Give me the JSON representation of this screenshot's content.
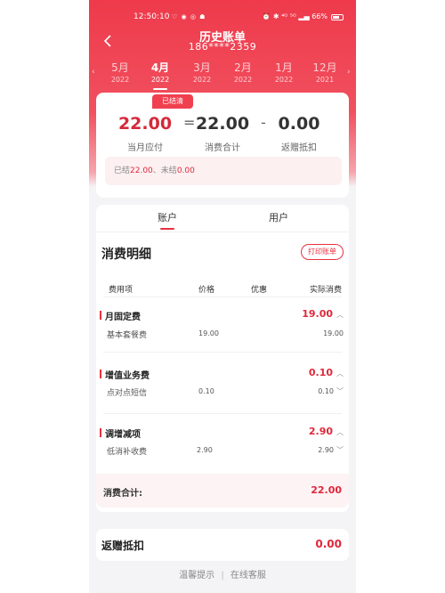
{
  "status": {
    "time": "12:50:10",
    "app_icons": "♡ ◉ ◎ ☗",
    "right_text": "⏰ ✱ ⁴ᴳ ⁵ᴳ ▂▄ 66%"
  },
  "header": {
    "title": "历史账单",
    "phone": "186****2359",
    "back_icon": "chevron-left-icon"
  },
  "months": [
    {
      "month": "5月",
      "year": "2022",
      "active": false
    },
    {
      "month": "4月",
      "year": "2022",
      "active": true
    },
    {
      "month": "3月",
      "year": "2022",
      "active": false
    },
    {
      "month": "2月",
      "year": "2022",
      "active": false
    },
    {
      "month": "1月",
      "year": "2022",
      "active": false
    },
    {
      "month": "12月",
      "year": "2021",
      "active": false
    }
  ],
  "summary": {
    "badge": "已结清",
    "due": {
      "value": "22.00",
      "label": "当月应付"
    },
    "equals": "=",
    "consumption": {
      "value": "22.00",
      "label": "消费合计"
    },
    "minus": "-",
    "rebate": {
      "value": "0.00",
      "label": "返赠抵扣"
    },
    "paid_prefix": "已结",
    "paid_amount": "22.00",
    "paid_sep": "、",
    "unpaid_prefix": "未结",
    "unpaid_amount": "0.00"
  },
  "tabs": [
    {
      "label": "账户",
      "active": true
    },
    {
      "label": "用户",
      "active": false
    }
  ],
  "details": {
    "title": "消费明细",
    "print_label": "打印账单",
    "columns": [
      "费用项",
      "价格",
      "优惠",
      "实际消费"
    ],
    "groups": [
      {
        "name": "月固定费",
        "amount": "19.00",
        "item": {
          "name": "基本套餐费",
          "price": "19.00",
          "amount": "19.00"
        }
      },
      {
        "name": "增值业务费",
        "amount": "0.10",
        "item": {
          "name": "点对点短信",
          "price": "0.10",
          "amount": "0.10"
        }
      },
      {
        "name": "调增减项",
        "amount": "2.90",
        "item": {
          "name": "低消补收费",
          "price": "2.90",
          "amount": "2.90"
        }
      }
    ],
    "total_label": "消费合计:",
    "total_amount": "22.00"
  },
  "rebate": {
    "label": "返赠抵扣",
    "amount": "0.00"
  },
  "footer": {
    "tip": "温馨提示",
    "divider": "|",
    "service": "在线客服"
  },
  "colors": {
    "brand_red": "#ee3a4b",
    "amount_red": "#e0283b"
  }
}
